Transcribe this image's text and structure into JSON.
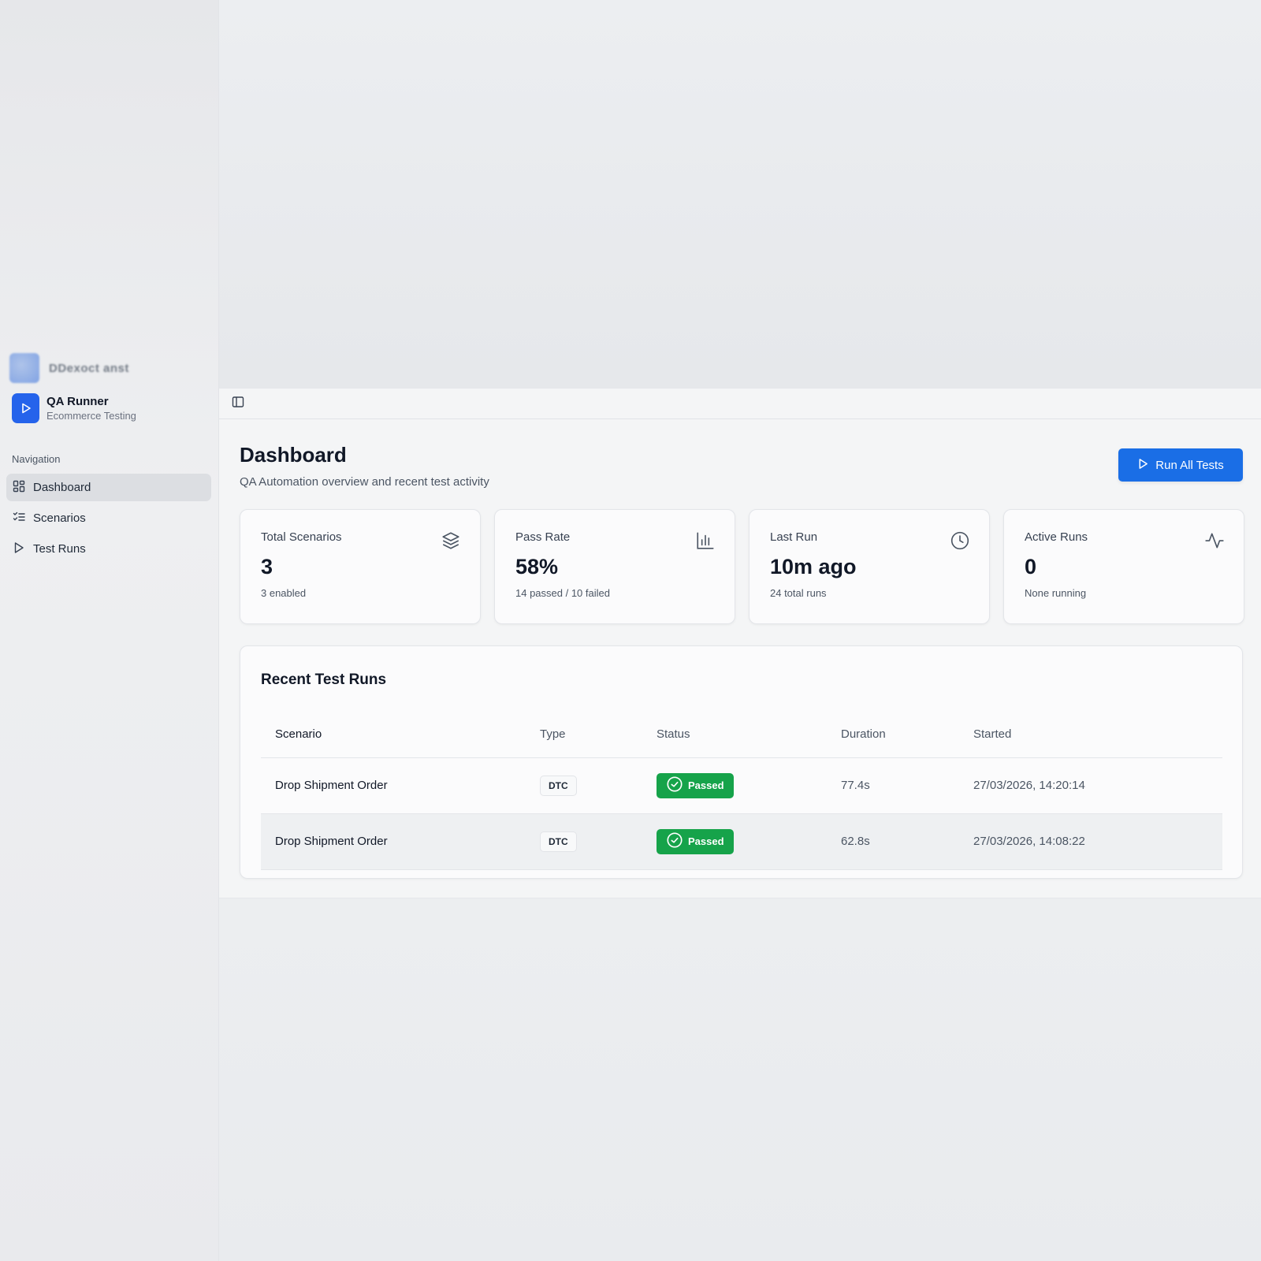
{
  "ghost_header": {
    "text": "DDexoct anst"
  },
  "brand": {
    "title": "QA Runner",
    "subtitle": "Ecommerce Testing",
    "logo_icon": "play-icon"
  },
  "sidebar": {
    "section_label": "Navigation",
    "items": [
      {
        "label": "Dashboard",
        "icon": "grid-icon",
        "active": true
      },
      {
        "label": "Scenarios",
        "icon": "checklist-icon",
        "active": false
      },
      {
        "label": "Test Runs",
        "icon": "play-icon",
        "active": false
      }
    ]
  },
  "header": {
    "title": "Dashboard",
    "subtitle": "QA Automation overview and recent test activity",
    "run_all_label": "Run All Tests"
  },
  "stats": [
    {
      "label": "Total Scenarios",
      "value": "3",
      "note": "3 enabled",
      "icon": "layers-icon"
    },
    {
      "label": "Pass Rate",
      "value": "58%",
      "note": "14 passed / 10 failed",
      "icon": "bar-chart-icon"
    },
    {
      "label": "Last Run",
      "value": "10m ago",
      "note": "24 total runs",
      "icon": "clock-icon"
    },
    {
      "label": "Active Runs",
      "value": "0",
      "note": "None running",
      "icon": "activity-icon"
    }
  ],
  "recent_runs": {
    "title": "Recent Test Runs",
    "columns": [
      "Scenario",
      "Type",
      "Status",
      "Duration",
      "Started"
    ],
    "rows": [
      {
        "scenario": "Drop Shipment Order",
        "type": "DTC",
        "status": "Passed",
        "duration": "77.4s",
        "started": "27/03/2026, 14:20:14"
      },
      {
        "scenario": "Drop Shipment Order",
        "type": "DTC",
        "status": "Passed",
        "duration": "62.8s",
        "started": "27/03/2026, 14:08:22"
      }
    ]
  },
  "colors": {
    "accent": "#1a6ee6",
    "success": "#16a34a",
    "active_nav": "#dcdee2"
  }
}
